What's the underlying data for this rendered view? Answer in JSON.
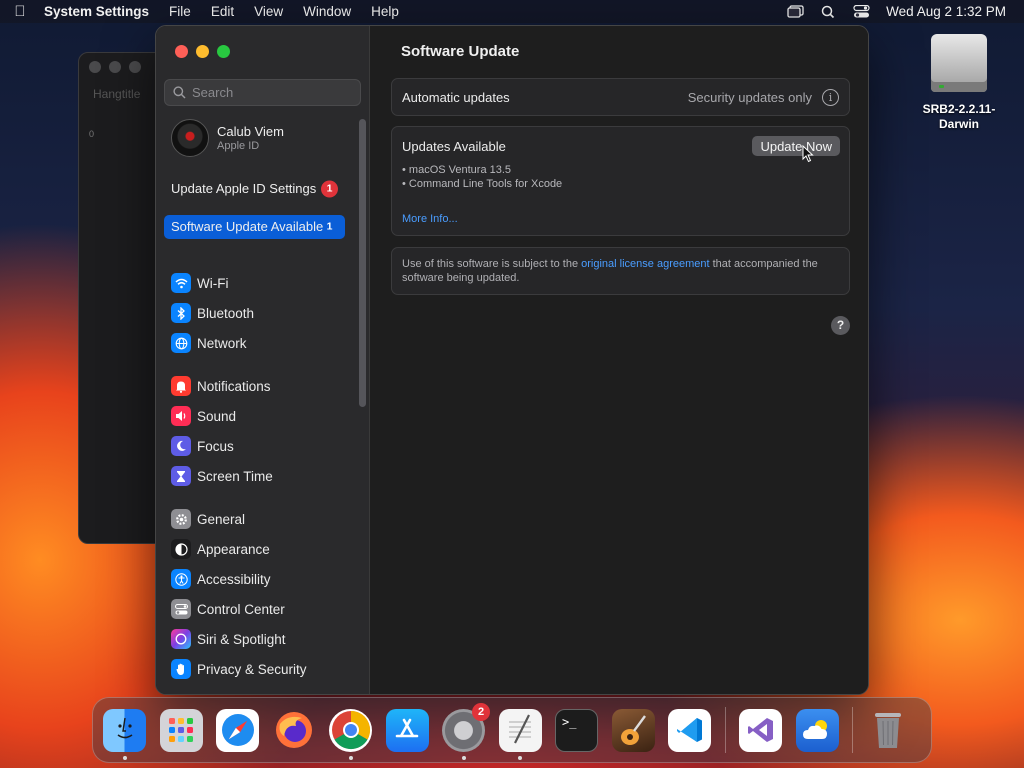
{
  "menubar": {
    "app_name": "System Settings",
    "menus": [
      "File",
      "Edit",
      "View",
      "Window",
      "Help"
    ],
    "datetime": "Wed Aug 2  1:32 PM"
  },
  "ghost_window": {
    "title": "Hangtitle",
    "zero": "0"
  },
  "desktop": {
    "disk_label": "SRB2-2.2.11-Darwin"
  },
  "sidebar": {
    "search_placeholder": "Search",
    "account": {
      "name": "Calub Viem",
      "subtitle": "Apple ID"
    },
    "notices": [
      {
        "label": "Update Apple ID Settings",
        "badge": "1"
      },
      {
        "label": "Software Update Available",
        "badge": "1"
      }
    ],
    "groups": [
      [
        {
          "label": "Wi-Fi",
          "icon": "wifi-icon",
          "color": "#0a84ff"
        },
        {
          "label": "Bluetooth",
          "icon": "bluetooth-icon",
          "color": "#0a84ff"
        },
        {
          "label": "Network",
          "icon": "globe-icon",
          "color": "#0a84ff"
        }
      ],
      [
        {
          "label": "Notifications",
          "icon": "bell-icon",
          "color": "#ff3b30"
        },
        {
          "label": "Sound",
          "icon": "speaker-icon",
          "color": "#ff2d55"
        },
        {
          "label": "Focus",
          "icon": "moon-icon",
          "color": "#5e5ce6"
        },
        {
          "label": "Screen Time",
          "icon": "hourglass-icon",
          "color": "#5e5ce6"
        }
      ],
      [
        {
          "label": "General",
          "icon": "gear-icon",
          "color": "#8e8e93"
        },
        {
          "label": "Appearance",
          "icon": "appearance-icon",
          "color": "#1c1c1e"
        },
        {
          "label": "Accessibility",
          "icon": "accessibility-icon",
          "color": "#0a84ff"
        },
        {
          "label": "Control Center",
          "icon": "toggles-icon",
          "color": "#8e8e93"
        },
        {
          "label": "Siri & Spotlight",
          "icon": "siri-icon",
          "color": "#7b3fe4"
        },
        {
          "label": "Privacy & Security",
          "icon": "hand-icon",
          "color": "#0a84ff"
        }
      ]
    ]
  },
  "content": {
    "title": "Software Update",
    "automatic_updates": {
      "label": "Automatic updates",
      "value": "Security updates only"
    },
    "updates": {
      "title": "Updates Available",
      "button": "Update Now",
      "items": [
        "• macOS Ventura 13.5",
        "• Command Line Tools for Xcode"
      ],
      "more_info": "More Info..."
    },
    "license": {
      "before": "Use of this software is subject to the ",
      "link": "original license agreement",
      "after": " that accompanied the software being updated."
    },
    "help": "?"
  },
  "dock": {
    "apps": [
      {
        "name": "finder-icon",
        "color": "#1e7cf2",
        "running": true
      },
      {
        "name": "launchpad-icon",
        "color": "#c8c8cc",
        "running": false
      },
      {
        "name": "safari-icon",
        "color": "#ffffff",
        "running": false
      },
      {
        "name": "firefox-icon",
        "color": "#ff7139",
        "running": false
      },
      {
        "name": "chrome-icon",
        "color": "#ffffff",
        "running": true
      },
      {
        "name": "app-store-icon",
        "color": "#1f8af5",
        "running": false
      },
      {
        "name": "system-settings-icon",
        "color": "#8a8a8e",
        "running": true,
        "badge": "2"
      },
      {
        "name": "textedit-icon",
        "color": "#f2f2f2",
        "running": true
      },
      {
        "name": "terminal-icon",
        "color": "#1c1c1c",
        "running": false
      },
      {
        "name": "garageband-icon",
        "color": "#5a3e2b",
        "running": false
      },
      {
        "name": "vscode-icon",
        "color": "#ffffff",
        "running": false
      },
      {
        "name": "visual-studio-icon",
        "color": "#ffffff",
        "running": false
      },
      {
        "name": "weather-icon",
        "color": "#2c7be5",
        "running": false
      },
      {
        "name": "trash-icon",
        "color": "#b0b0b4",
        "running": false
      }
    ]
  }
}
